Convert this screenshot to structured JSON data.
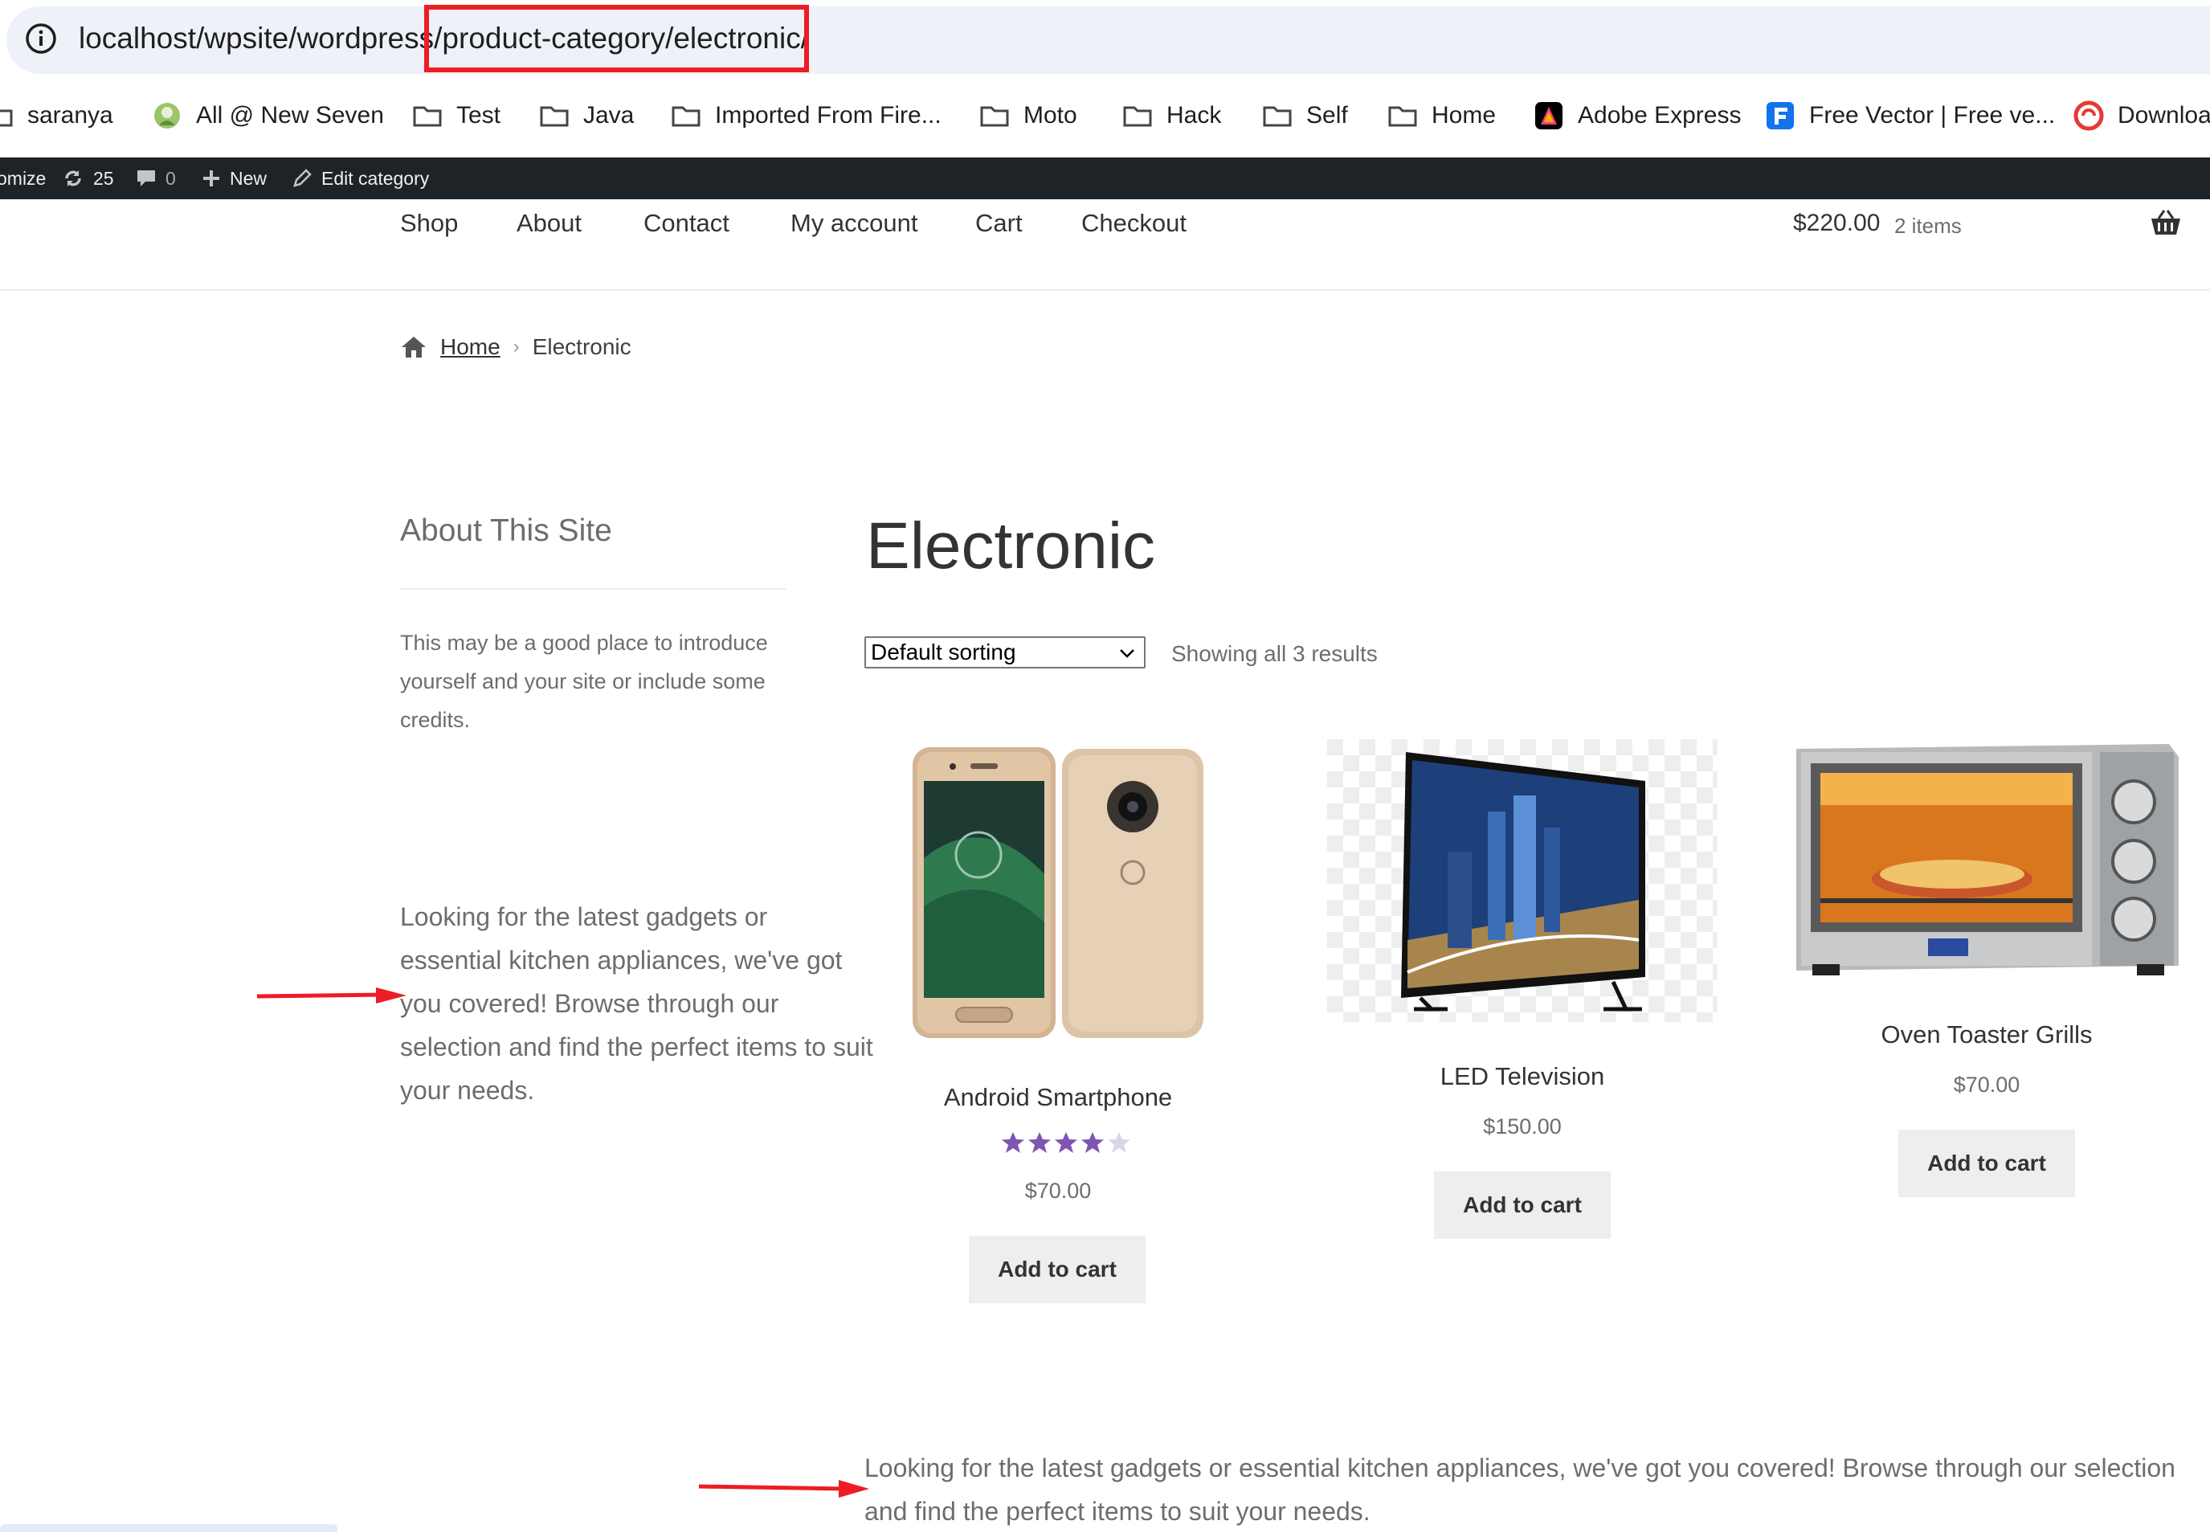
{
  "browser": {
    "url": "localhost/wpsite/wordpress/product-category/electronic/",
    "bookmarks": [
      {
        "label": "saranya",
        "icon": "folder-icon"
      },
      {
        "label": "All @ New Seven",
        "icon": "site-favicon"
      },
      {
        "label": "Test",
        "icon": "folder-icon"
      },
      {
        "label": "Java",
        "icon": "folder-icon"
      },
      {
        "label": "Imported From Fire...",
        "icon": "folder-icon"
      },
      {
        "label": "Moto",
        "icon": "folder-icon"
      },
      {
        "label": "Hack",
        "icon": "folder-icon"
      },
      {
        "label": "Self",
        "icon": "folder-icon"
      },
      {
        "label": "Home",
        "icon": "folder-icon"
      },
      {
        "label": "Adobe Express",
        "icon": "adobe-express-icon"
      },
      {
        "label": "Free Vector | Free ve...",
        "icon": "freepik-icon"
      },
      {
        "label": "Downloa",
        "icon": "download-site-icon"
      }
    ]
  },
  "admin_bar": {
    "customize": "omize",
    "updates": "25",
    "comments": "0",
    "new": "New",
    "edit": "Edit category"
  },
  "nav": {
    "items": [
      "Shop",
      "About",
      "Contact",
      "My account",
      "Cart",
      "Checkout"
    ],
    "cart_total": "$220.00",
    "cart_count": "2 items"
  },
  "breadcrumb": {
    "home": "Home",
    "current": "Electronic"
  },
  "sidebar": {
    "title": "About This Site",
    "text": "This may be a good place to introduce yourself and your site or include some credits.",
    "description": "Looking for the latest gadgets or essential kitchen appliances, we've got you covered! Browse through our selection and find the perfect items to suit your needs."
  },
  "main": {
    "title": "Electronic",
    "sort_selected": "Default sorting",
    "result_count": "Showing all 3 results",
    "products": [
      {
        "name": "Android Smartphone",
        "price": "$70.00",
        "rating": 4,
        "rating_max": 5,
        "button": "Add to cart"
      },
      {
        "name": "LED Television",
        "price": "$150.00",
        "button": "Add to cart"
      },
      {
        "name": "Oven Toaster Grills",
        "price": "$70.00",
        "button": "Add to cart"
      }
    ],
    "bottom_description": "Looking for the latest gadgets or essential kitchen appliances, we've got you covered! Browse through our selection and find the perfect items to suit your needs."
  },
  "colors": {
    "admin_bar": "#1d2327",
    "highlight": "#ee1c25",
    "star": "#7f54b3",
    "button_bg": "#eeeeee"
  }
}
